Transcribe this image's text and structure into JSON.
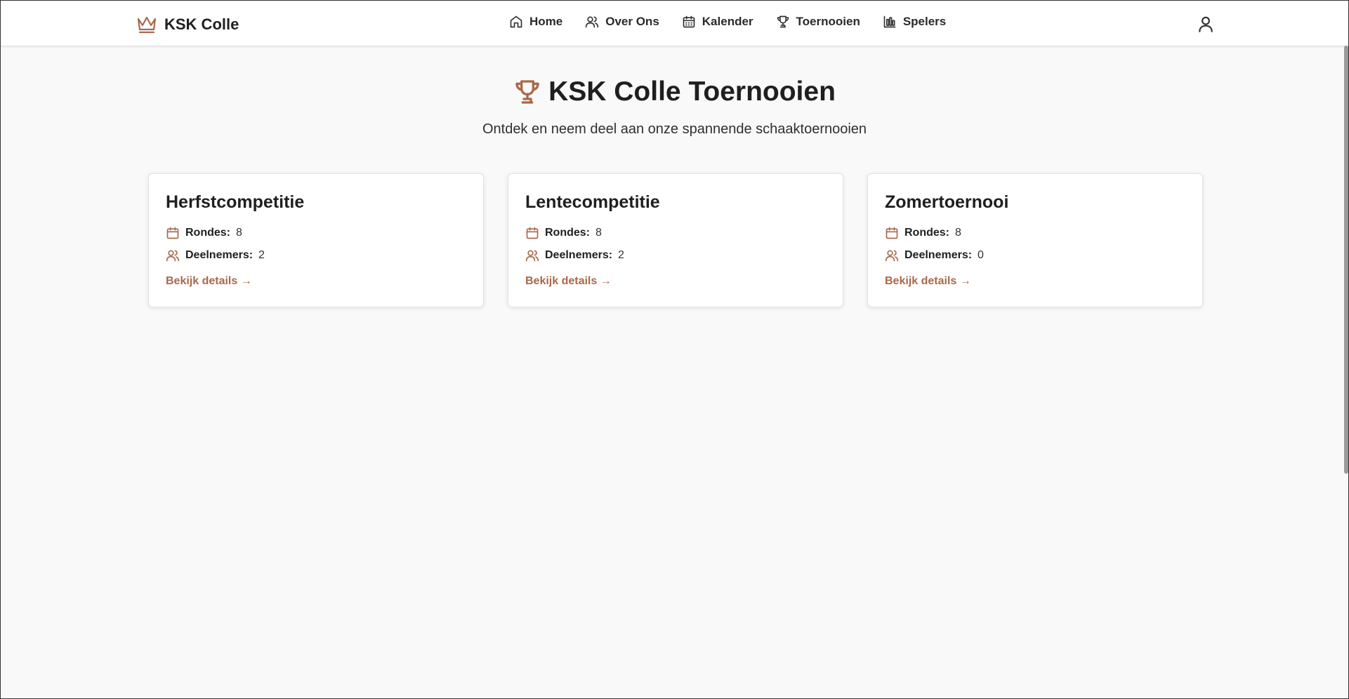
{
  "nav": {
    "brand": "KSK Colle",
    "links": [
      {
        "label": "Home",
        "icon": "home-icon"
      },
      {
        "label": "Over Ons",
        "icon": "users-icon"
      },
      {
        "label": "Kalender",
        "icon": "calendar-icon"
      },
      {
        "label": "Toernooien",
        "icon": "trophy-icon"
      },
      {
        "label": "Spelers",
        "icon": "bar-chart-icon"
      }
    ]
  },
  "hero": {
    "title": "KSK Colle Toernooien",
    "subtitle": "Ontdek en neem deel aan onze spannende schaaktoernooien"
  },
  "labels": {
    "rounds": "Rondes:",
    "participants": "Deelnemers:",
    "details": "Bekijk details →"
  },
  "tournaments": [
    {
      "name": "Herfstcompetitie",
      "rounds": "8",
      "participants": "2"
    },
    {
      "name": "Lentecompetitie",
      "rounds": "8",
      "participants": "2"
    },
    {
      "name": "Zomertoernooi",
      "rounds": "8",
      "participants": "0"
    }
  ],
  "colors": {
    "accent": "#a8694a",
    "background": "#f9f9f9",
    "card": "#ffffff"
  }
}
